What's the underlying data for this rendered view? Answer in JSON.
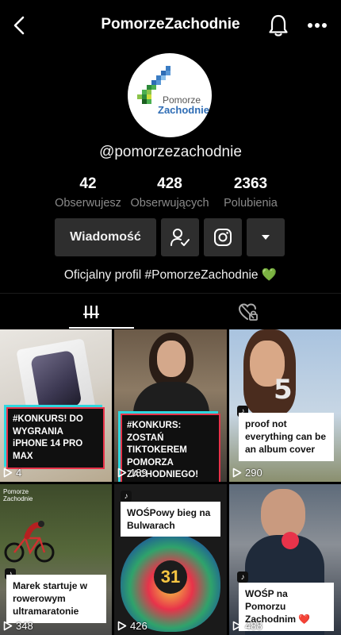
{
  "header": {
    "title": "PomorzeZachodnie"
  },
  "profile": {
    "logo_line1": "Pomorze",
    "logo_line2": "Zachodnie",
    "handle": "@pomorzezachodnie",
    "bio": "Oficjalny profil #PomorzeZachodnie 💚"
  },
  "stats": [
    {
      "value": "42",
      "label": "Obserwujesz"
    },
    {
      "value": "428",
      "label": "Obserwujących"
    },
    {
      "value": "2363",
      "label": "Polubienia"
    }
  ],
  "actions": {
    "message_label": "Wiadomość"
  },
  "videos": [
    {
      "caption": "#KONKURS! DO WYGRANIA iPHONE 14 PRO MAX",
      "views": "4"
    },
    {
      "caption": "#KONKURS: ZOSTAŃ TIKTOKEREM POMORZA ZACHODNIEGO!",
      "views": "189"
    },
    {
      "caption": "proof not everything can be an album cover",
      "views": "290"
    },
    {
      "caption": "Marek startuje w rowerowym ultramaratonie",
      "views": "348"
    },
    {
      "caption": "WOŚPowy bieg na Bulwarach",
      "views": "426"
    },
    {
      "caption": "WOŚP na Pomorzu Zachodnim ❤️",
      "views": "488"
    }
  ],
  "thumbnail_overlays": {
    "video4_logo": "Pomorze Zachodnie",
    "video5_medal": "31",
    "video3_number": "5"
  },
  "colors": {
    "background": "#000000",
    "button_bg": "#2e2e2e",
    "muted_text": "#8a8a8a",
    "caption_border": "#e8334a",
    "caption_shadow": "#2ed8e0",
    "logo_green": "#4caf50",
    "logo_blue": "#2f6db5"
  },
  "icons": {
    "back": "chevron-left-icon",
    "bell": "bell-icon",
    "more": "more-horizontal-icon",
    "follow": "user-check-icon",
    "instagram": "instagram-icon",
    "dropdown": "triangle-down-icon",
    "videos_tab": "grid-bars-icon",
    "liked_tab": "heart-lock-icon",
    "play": "play-icon"
  }
}
